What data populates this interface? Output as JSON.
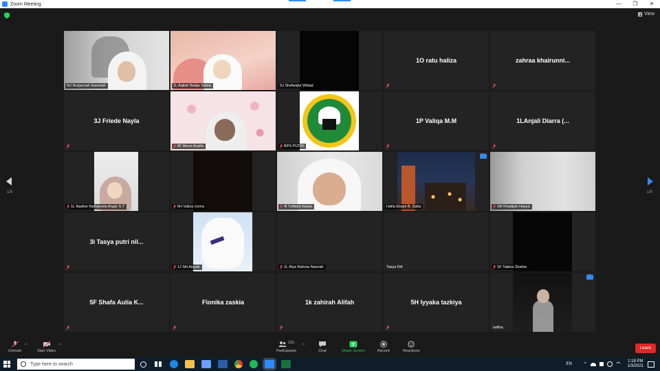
{
  "window": {
    "title": "Zoom Meeting",
    "controls": [
      "—",
      "❐",
      "✕"
    ]
  },
  "meeting": {
    "view_label": "View",
    "page_left": "1/5",
    "page_right": "1/5"
  },
  "tiles": [
    {
      "label": "5H Nurjannah Kasmiah",
      "big": "",
      "muted": false,
      "active": true
    },
    {
      "label": "1L Aqilah Balqis Sabta",
      "big": "",
      "muted": false
    },
    {
      "label": "5J Shofwatul Widad",
      "big": "",
      "muted": false
    },
    {
      "label": "",
      "big": "1O ratu haliza",
      "muted": true
    },
    {
      "label": "",
      "big": "zahraa  khairunni...",
      "muted": true
    },
    {
      "label": "",
      "big": "3J Friede Nayla",
      "muted": true
    },
    {
      "label": "5F Ainun Asyifa",
      "big": "",
      "muted": true
    },
    {
      "label": "BPS PUTRI",
      "big": "",
      "muted": true
    },
    {
      "label": "",
      "big": "1P Valiqa M.M",
      "muted": true
    },
    {
      "label": "",
      "big": "1LAnjali Diarra  (...",
      "muted": true
    },
    {
      "label": "1L Nadine Nathaniela Angie S.T",
      "big": "",
      "muted": true
    },
    {
      "label": "5H Valiza Uzma",
      "big": "",
      "muted": true
    },
    {
      "label": "4I Tutfatul maula",
      "big": "",
      "muted": true
    },
    {
      "label": "Hafia Elsani B. Saba",
      "big": "",
      "muted": false
    },
    {
      "label": "1M Khadijah Hasya",
      "big": "",
      "muted": true
    },
    {
      "label": "",
      "big": "3i Tasya putri nil...",
      "muted": true
    },
    {
      "label": "1J Siti Aisyah",
      "big": "",
      "muted": true
    },
    {
      "label": "1L Alya Rahma Nazriah",
      "big": "",
      "muted": true
    },
    {
      "label": "Tasya RA",
      "big": "",
      "muted": false
    },
    {
      "label": "1K Tabina Shahia",
      "big": "",
      "muted": true
    },
    {
      "label": "",
      "big": "5F Shafa Aulia K...",
      "muted": true
    },
    {
      "label": "",
      "big": "Fionika zaskia",
      "muted": true
    },
    {
      "label": "",
      "big": "1k zahirah Alifah",
      "muted": true
    },
    {
      "label": "",
      "big": "5H Iyyaka tazkiya",
      "muted": true
    },
    {
      "label": "talitha",
      "big": "",
      "muted": false
    }
  ],
  "toolbar": {
    "unmute": "Unmute",
    "start_video": "Start Video",
    "participants": "Participants",
    "participants_count": "213",
    "chat": "Chat",
    "share_screen": "Share Screen",
    "record": "Record",
    "reactions": "Reactions",
    "leave": "Leave"
  },
  "taskbar": {
    "search_placeholder": "Type here to search",
    "lang": "EN",
    "time": "1:18 PM",
    "date": "1/3/2021"
  },
  "colors": {
    "accent": "#2d8cff",
    "active_speaker": "#b7dc50",
    "leave": "#e02828",
    "share": "#23d959"
  }
}
